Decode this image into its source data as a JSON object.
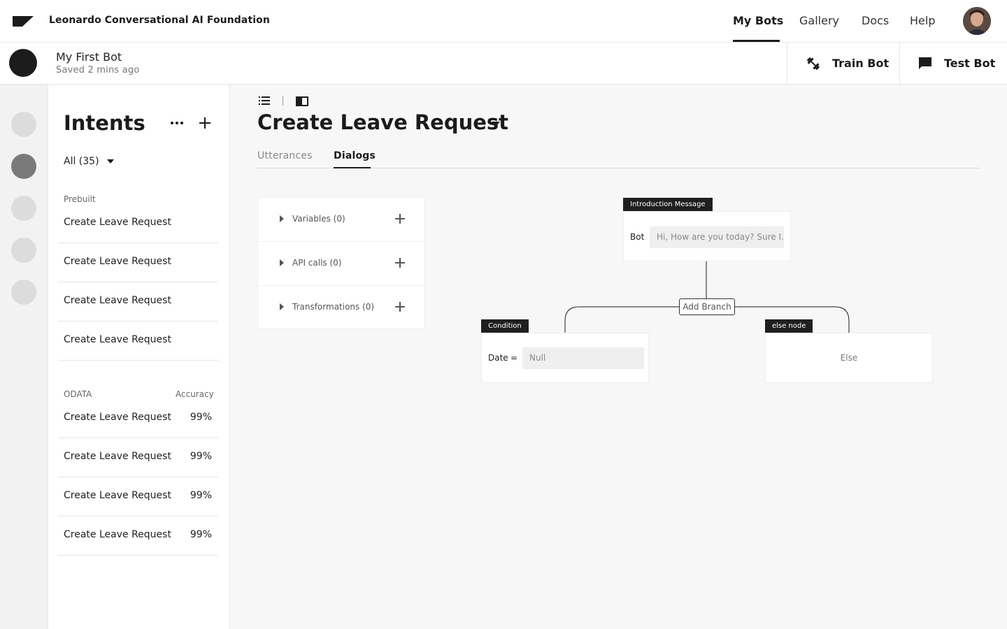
{
  "topnav": {
    "org_name": "Leonardo Conversational AI Foundation",
    "links": [
      {
        "label": "My Bots",
        "active": true
      },
      {
        "label": "Gallery"
      },
      {
        "label": "Docs"
      },
      {
        "label": "Help"
      }
    ]
  },
  "bot": {
    "name": "My First Bot",
    "saved": "Saved 2 mins ago",
    "train_label": "Train Bot",
    "test_label": "Test Bot"
  },
  "intents": {
    "title": "Intents",
    "filter": "All (35)",
    "prebuilt_label": "Prebuilt",
    "prebuilt_items": [
      "Create Leave Request",
      "Create Leave Request",
      "Create Leave Request",
      "Create Leave Request"
    ],
    "odata_label": "ODATA",
    "accuracy_label": "Accuracy",
    "odata_items": [
      {
        "label": "Create Leave Request",
        "accuracy": "99%"
      },
      {
        "label": "Create Leave Request",
        "accuracy": "99%"
      },
      {
        "label": "Create Leave Request",
        "accuracy": "99%"
      },
      {
        "label": "Create Leave Request",
        "accuracy": "99%"
      }
    ]
  },
  "main": {
    "title": "Create Leave Request",
    "tabs": [
      {
        "label": "Utterances",
        "active": false
      },
      {
        "label": "Dialogs",
        "active": true
      }
    ]
  },
  "props": [
    {
      "label": "Variables (0)"
    },
    {
      "label": "API calls (0)"
    },
    {
      "label": "Transformations (0)"
    }
  ],
  "flow": {
    "intro_tag": "Introduction Message",
    "intro_label": "Bot",
    "intro_value": "Hi, How are you today? Sure I...",
    "add_branch": "Add Branch",
    "condition_tag": "Condition",
    "condition_label": "Date",
    "condition_op": "=",
    "condition_value": "Null",
    "else_tag": "else node",
    "else_text": "Else"
  },
  "colors": {
    "accent": "#1b1b1b",
    "background": "#f7f7f7",
    "rail_active": "#7a7a7a"
  }
}
